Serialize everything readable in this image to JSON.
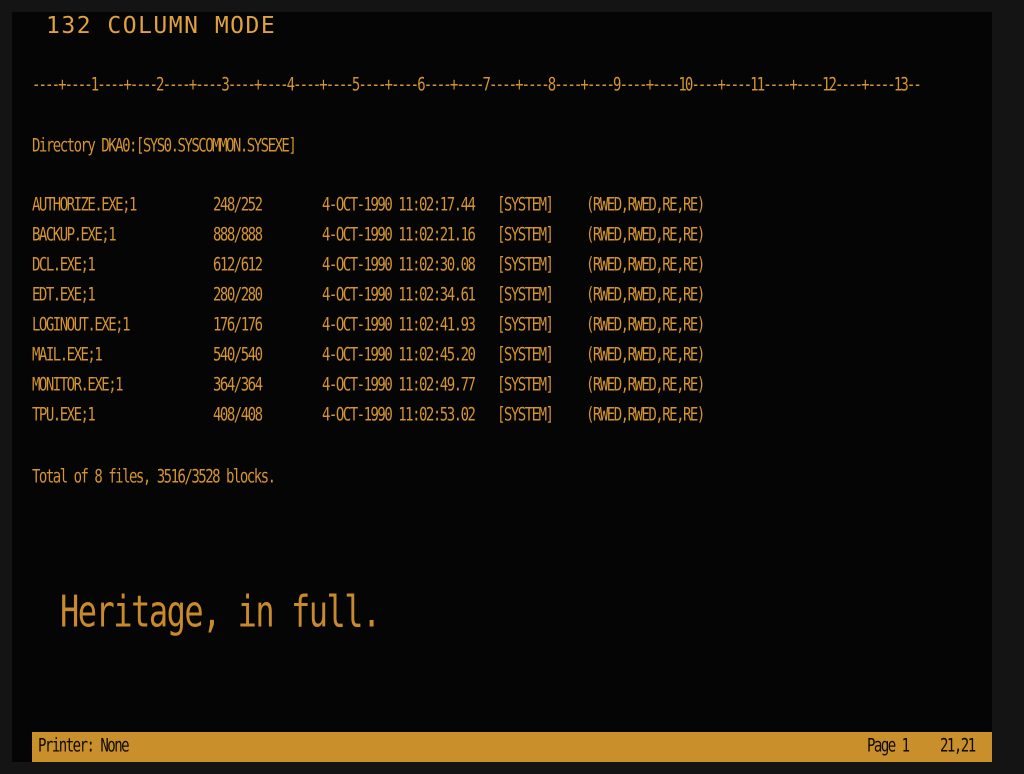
{
  "header": {
    "mode_title": "132 COLUMN MODE"
  },
  "ruler": {
    "text": "----+----1----+----2----+----3----+----4----+----5----+----6----+----7----+----8----+----9----+----10----+----11----+----12----+----13--"
  },
  "directory": {
    "heading": "Directory DKA0:[SYS0.SYSCOMMON.SYSEXE]",
    "files": [
      {
        "name": "AUTHORIZE.EXE;1",
        "size": "248/252",
        "date": "4-OCT-1990 11:02:17.44",
        "owner": "[SYSTEM]",
        "protection": "(RWED,RWED,RE,RE)"
      },
      {
        "name": "BACKUP.EXE;1",
        "size": "888/888",
        "date": "4-OCT-1990 11:02:21.16",
        "owner": "[SYSTEM]",
        "protection": "(RWED,RWED,RE,RE)"
      },
      {
        "name": "DCL.EXE;1",
        "size": "612/612",
        "date": "4-OCT-1990 11:02:30.08",
        "owner": "[SYSTEM]",
        "protection": "(RWED,RWED,RE,RE)"
      },
      {
        "name": "EDT.EXE;1",
        "size": "280/280",
        "date": "4-OCT-1990 11:02:34.61",
        "owner": "[SYSTEM]",
        "protection": "(RWED,RWED,RE,RE)"
      },
      {
        "name": "LOGINOUT.EXE;1",
        "size": "176/176",
        "date": "4-OCT-1990 11:02:41.93",
        "owner": "[SYSTEM]",
        "protection": "(RWED,RWED,RE,RE)"
      },
      {
        "name": "MAIL.EXE;1",
        "size": "540/540",
        "date": "4-OCT-1990 11:02:45.20",
        "owner": "[SYSTEM]",
        "protection": "(RWED,RWED,RE,RE)"
      },
      {
        "name": "MONITOR.EXE;1",
        "size": "364/364",
        "date": "4-OCT-1990 11:02:49.77",
        "owner": "[SYSTEM]",
        "protection": "(RWED,RWED,RE,RE)"
      },
      {
        "name": "TPU.EXE;1",
        "size": "408/408",
        "date": "4-OCT-1990 11:02:53.02",
        "owner": "[SYSTEM]",
        "protection": "(RWED,RWED,RE,RE)"
      }
    ],
    "total": "Total of 8 files, 3516/3528 blocks."
  },
  "slogan": "Heritage, in full.",
  "status_bar": {
    "printer": "Printer: None",
    "page": "Page 1",
    "cursor": "21,21"
  },
  "colors": {
    "phosphor_amber": "#d39431",
    "background": "#050505",
    "status_bar": "#c98f2a"
  }
}
